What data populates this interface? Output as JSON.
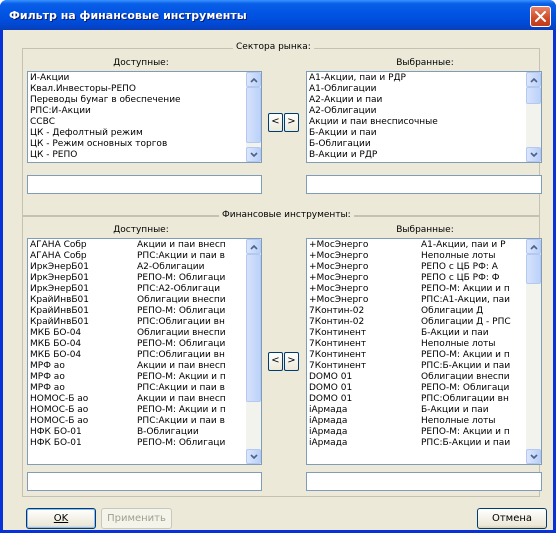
{
  "window": {
    "title": "Фильтр на финансовые инструменты"
  },
  "market": {
    "legend": "Сектора рынка:",
    "available_header": "Доступные:",
    "selected_header": "Выбранные:",
    "available": [
      "И-Акции",
      "Квал.Инвесторы-РЕПО",
      "Переводы бумаг в обеспечение",
      "РПС:И-Акции",
      "ССВС",
      "ЦК - Дефолтный режим",
      "ЦК - Режим основных торгов",
      "ЦК - РЕПО"
    ],
    "selected": [
      "А1-Акции, паи и РДР",
      "А1-Облигации",
      "А2-Акции и паи",
      "А2-Облигации",
      "Акции и паи внесписочные",
      "Б-Акции и паи",
      "Б-Облигации",
      "В-Акции и РДР"
    ],
    "move_left": "<",
    "move_right": ">"
  },
  "instruments": {
    "legend": "Финансовые инструменты:",
    "available_header": "Доступные:",
    "selected_header": "Выбранные:",
    "available": [
      [
        "АГАНА Собр",
        "Акции и паи внесп"
      ],
      [
        "АГАНА Собр",
        "РПС:Акции и паи в"
      ],
      [
        "ИркЭнерБ01",
        "А2-Облигации"
      ],
      [
        "ИркЭнерБ01",
        "РЕПО-М: Облигаци"
      ],
      [
        "ИркЭнерБ01",
        "РПС:А2-Облигаци"
      ],
      [
        "КрайИнвБ01",
        "Облигации внеспи"
      ],
      [
        "КрайИнвБ01",
        "РЕПО-М: Облигаци"
      ],
      [
        "КрайИнвБ01",
        "РПС:Облигации вн"
      ],
      [
        "МКБ БО-04",
        "Облигации внеспи"
      ],
      [
        "МКБ БО-04",
        "РЕПО-М: Облигаци"
      ],
      [
        "МКБ БО-04",
        "РПС:Облигации вн"
      ],
      [
        "МРФ ао",
        "Акции и паи внесп"
      ],
      [
        "МРФ ао",
        "РЕПО-М: Акции и п"
      ],
      [
        "МРФ ао",
        "РПС:Акции и паи в"
      ],
      [
        "НОМОС-Б ао",
        "Акции и паи внесп"
      ],
      [
        "НОМОС-Б ао",
        "РЕПО-М: Акции и п"
      ],
      [
        "НОМОС-Б ао",
        "РПС:Акции и паи в"
      ],
      [
        "НФК БО-01",
        "В-Облигации"
      ],
      [
        "НФК БО-01",
        "РЕПО-М: Облигаци"
      ]
    ],
    "selected": [
      [
        "+МосЭнерго",
        "А1-Акции, паи и Р"
      ],
      [
        "+МосЭнерго",
        "Неполные лоты"
      ],
      [
        "+МосЭнерго",
        "РЕПО с ЦБ РФ: А"
      ],
      [
        "+МосЭнерго",
        "РЕПО с ЦБ РФ: Ф"
      ],
      [
        "+МосЭнерго",
        "РЕПО-М: Акции и п"
      ],
      [
        "+МосЭнерго",
        "РПС:А1-Акции, паи"
      ],
      [
        "7Контин-02",
        "Облигации Д"
      ],
      [
        "7Контин-02",
        "Облигации Д - РПС"
      ],
      [
        "7Континент",
        "Б-Акции и паи"
      ],
      [
        "7Континент",
        "Неполные лоты"
      ],
      [
        "7Континент",
        "РЕПО-М: Акции и п"
      ],
      [
        "7Континент",
        "РПС:Б-Акции и паи"
      ],
      [
        "DOMO 01",
        "Облигации внеспи"
      ],
      [
        "DOMO 01",
        "РЕПО-М: Облигаци"
      ],
      [
        "DOMO 01",
        "РПС:Облигации вн"
      ],
      [
        "iАрмада",
        "Б-Акции и паи"
      ],
      [
        "iАрмада",
        "Неполные лоты"
      ],
      [
        "iАрмада",
        "РЕПО-М: Акции и п"
      ],
      [
        "iАрмада",
        "РПС:Б-Акции и паи"
      ]
    ],
    "move_left": "<",
    "move_right": ">"
  },
  "buttons": {
    "ok": "OK",
    "apply": "Применить",
    "cancel": "Отмена"
  },
  "colors": {
    "titlebar": "#0054e3",
    "face": "#ece9d8",
    "listborder": "#7f9db9",
    "close": "#d04a26"
  }
}
